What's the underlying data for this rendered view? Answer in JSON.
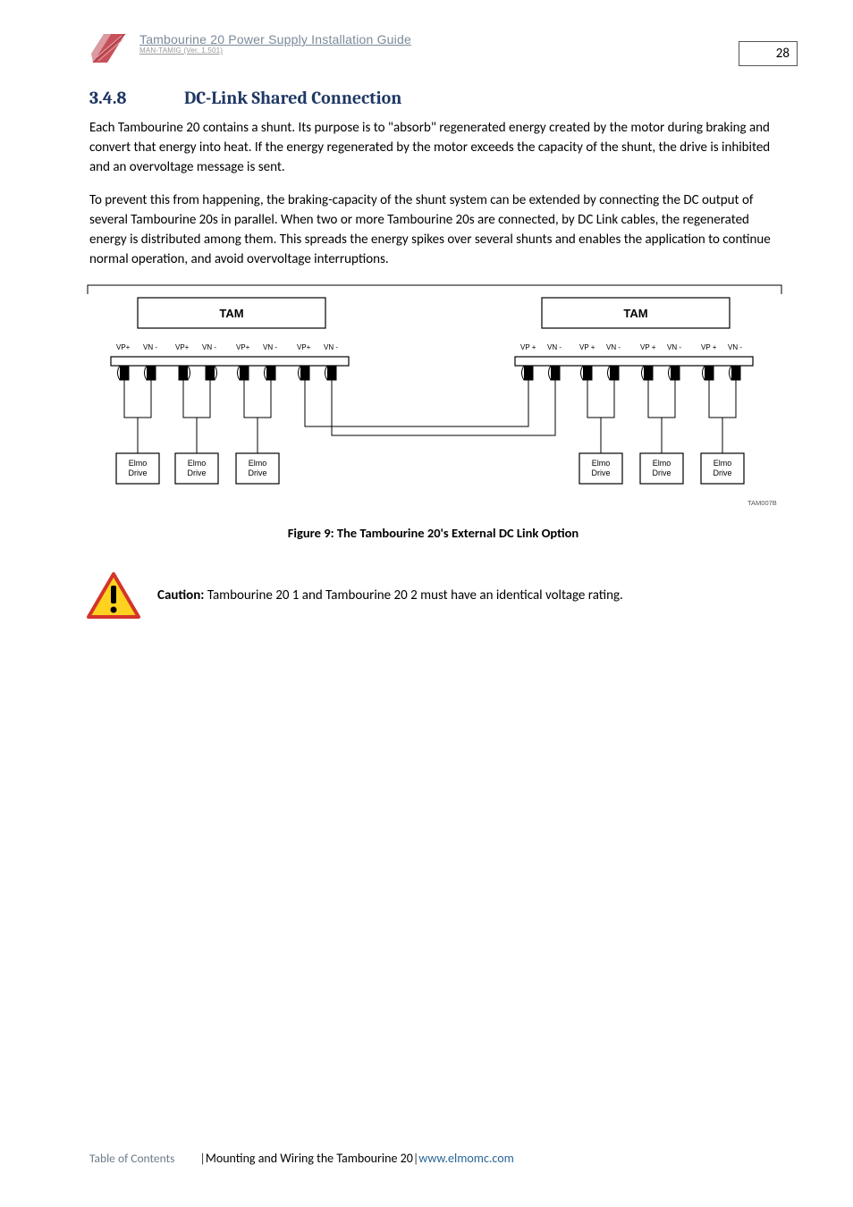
{
  "header": {
    "doc_title": "Tambourine 20 Power Supply Installation Guide",
    "doc_ver": "MAN-TAMIG (Ver. 1.501)",
    "page_number": "28"
  },
  "section": {
    "number": "3.4.8",
    "title": "DC-Link Shared Connection"
  },
  "paragraphs": {
    "p1": "Each Tambourine 20 contains a shunt. Its purpose is to \"absorb\" regenerated energy created by the motor during braking and convert that energy into heat. If the energy regenerated by the motor exceeds the capacity of the shunt, the drive is inhibited and an overvoltage message is sent.",
    "p2": "To prevent this from happening, the braking-capacity of the shunt system can be extended by connecting the DC output of several Tambourine 20s in parallel. When two or more Tambourine 20s are connected, by DC Link cables, the regenerated energy is distributed among them. This spreads the energy spikes over several shunts and enables the application to continue normal operation, and avoid overvoltage interruptions."
  },
  "figure": {
    "tam_label": "TAM",
    "pin_vp_plus": "VP+",
    "pin_vn_minus": "VN -",
    "pin_vp_plus_sp": "VP +",
    "elmo_line1": "Elmo",
    "elmo_line2": "Drive",
    "code": "TAM007B",
    "caption": "Figure 9: The Tambourine 20's External DC Link Option"
  },
  "caution": {
    "label": "Caution:",
    "text": " Tambourine 20 1 and Tambourine 20 2 must have an identical voltage rating."
  },
  "footer": {
    "toc": "Table of Contents",
    "chapter": "Mounting and Wiring the Tambourine 20",
    "url": "www.elmomc.com"
  }
}
